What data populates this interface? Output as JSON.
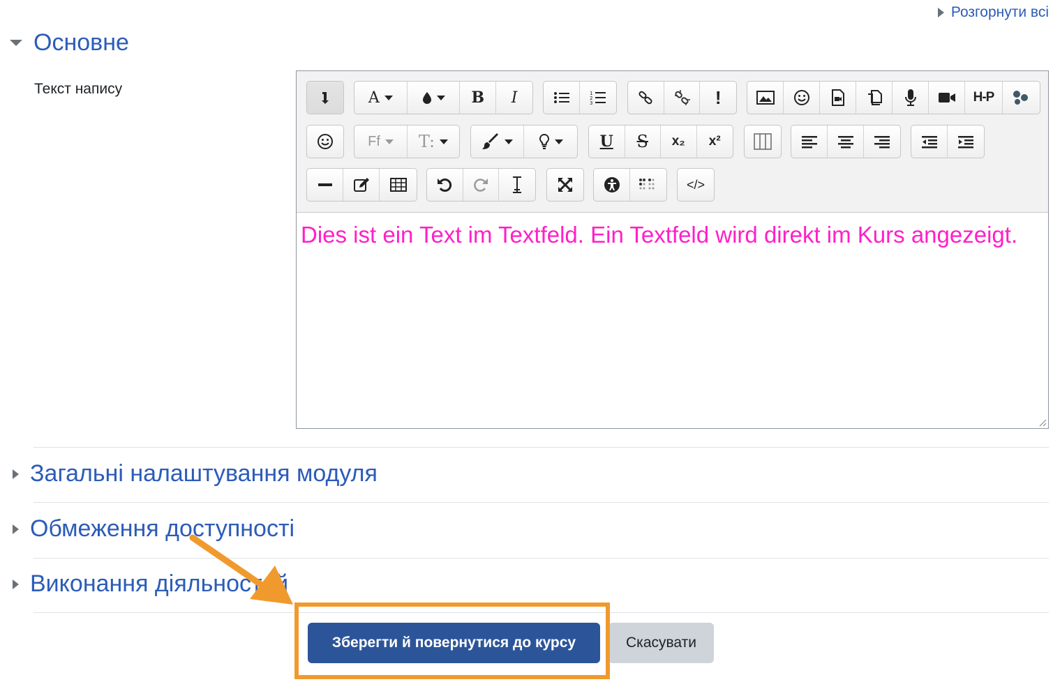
{
  "header": {
    "expand_all_label": "Розгорнути всі"
  },
  "sections": {
    "main_title": "Основне",
    "field_label": "Текст напису",
    "collapsed": [
      "Загальні налаштування модуля",
      "Обмеження доступності",
      "Виконання діяльностей"
    ]
  },
  "editor": {
    "content": "Dies ist ein Text im Textfeld. Ein Textfeld wird direkt im Kurs angezeigt.",
    "content_color": "#ff1fc8",
    "toolbar_labels": {
      "bold": "B",
      "italic": "I",
      "font_color": "A",
      "underline": "U",
      "strike": "S",
      "subscript": "x₂",
      "superscript": "x²",
      "font_family": "Ff",
      "font_size": "T:",
      "accessibility_warning": "!",
      "h5p": "H-P",
      "html": "</>"
    }
  },
  "actions": {
    "save_label": "Зберегти й повернутися до курсу",
    "cancel_label": "Скасувати"
  },
  "colors": {
    "accent": "#2c5cb8",
    "primary_button": "#2c5599",
    "highlight": "#f09a2e"
  }
}
